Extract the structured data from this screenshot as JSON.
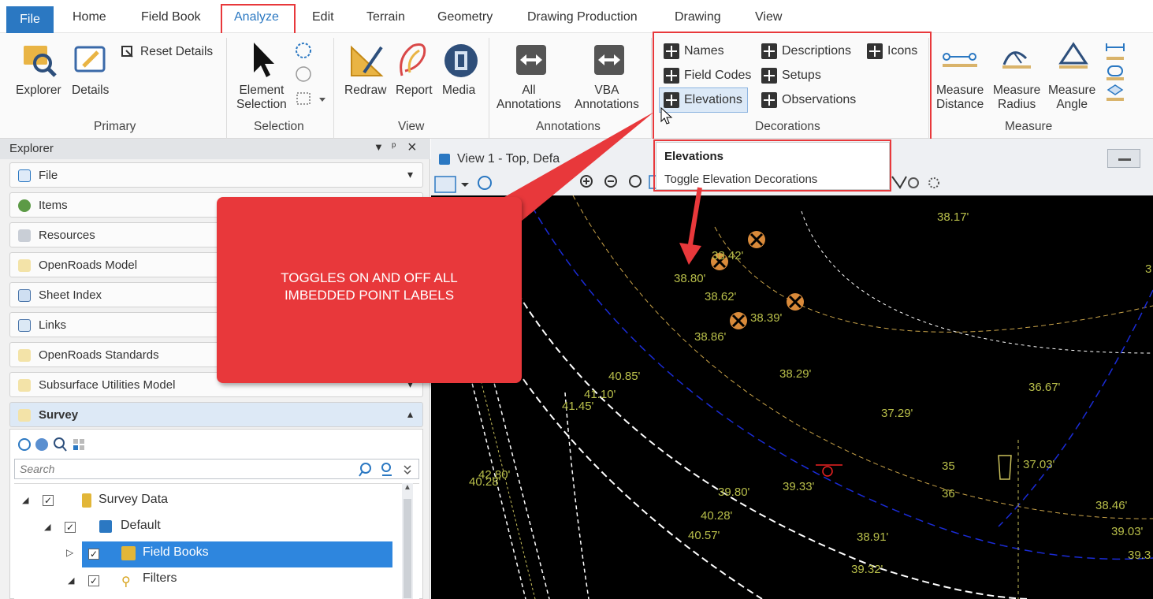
{
  "menu": {
    "tabs": [
      "File",
      "Home",
      "Field Book",
      "Analyze",
      "Edit",
      "Terrain",
      "Geometry",
      "Drawing Production",
      "Drawing",
      "View"
    ]
  },
  "ribbon": {
    "primary": {
      "explorer": "Explorer",
      "details": "Details",
      "reset": "Reset Details",
      "group": "Primary"
    },
    "selection": {
      "element": "Element",
      "element2": "Selection",
      "group": "Selection"
    },
    "view": {
      "redraw": "Redraw",
      "report": "Report",
      "media": "Media",
      "group": "View"
    },
    "annotations": {
      "all1": "All",
      "all2": "Annotations",
      "vba1": "VBA",
      "vba2": "Annotations",
      "group": "Annotations"
    },
    "decorations": {
      "names": "Names",
      "descriptions": "Descriptions",
      "icons": "Icons",
      "fieldcodes": "Field Codes",
      "setups": "Setups",
      "elevations": "Elevations",
      "observations": "Observations",
      "group": "Decorations"
    },
    "measure": {
      "dist1": "Measure",
      "dist2": "Distance",
      "rad1": "Measure",
      "rad2": "Radius",
      "ang1": "Measure",
      "ang2": "Angle",
      "group": "Measure"
    }
  },
  "tooltip": {
    "title": "Elevations",
    "desc": "Toggle Elevation Decorations"
  },
  "callout": {
    "text1": "TOGGLES ON AND OFF ALL",
    "text2": "IMBEDDED POINT LABELS"
  },
  "explorer": {
    "title": "Explorer",
    "items": [
      "File",
      "Items",
      "Resources",
      "OpenRoads Model",
      "Sheet Index",
      "Links",
      "OpenRoads Standards",
      "Subsurface Utilities Model"
    ],
    "survey": "Survey",
    "search_placeholder": "Search",
    "tree": {
      "root": "Survey Data",
      "default": "Default",
      "fieldbooks": "Field Books",
      "filters": "Filters"
    }
  },
  "view": {
    "title": "View 1 - Top, Defa"
  },
  "elevations": [
    "38.17'",
    "38.42'",
    "38.80'",
    "38.62'",
    "38.39'",
    "38.86'",
    "40.85'",
    "41.10'",
    "41.45'",
    "38.29'",
    "36.67'",
    "37.29'",
    "37.03'",
    "42.80'",
    "40.28'",
    "39.80'",
    "39.33'",
    "40.28'",
    "40.57'",
    "38.91'",
    "39.32'",
    "38.46'",
    "39.03'",
    "3",
    "39.3",
    "35",
    "36"
  ],
  "colors": {
    "accent": "#e8383b",
    "file_tab": "#2b78c2",
    "selected_row": "#2e86de",
    "elevation_text": "#b9bf4a"
  }
}
